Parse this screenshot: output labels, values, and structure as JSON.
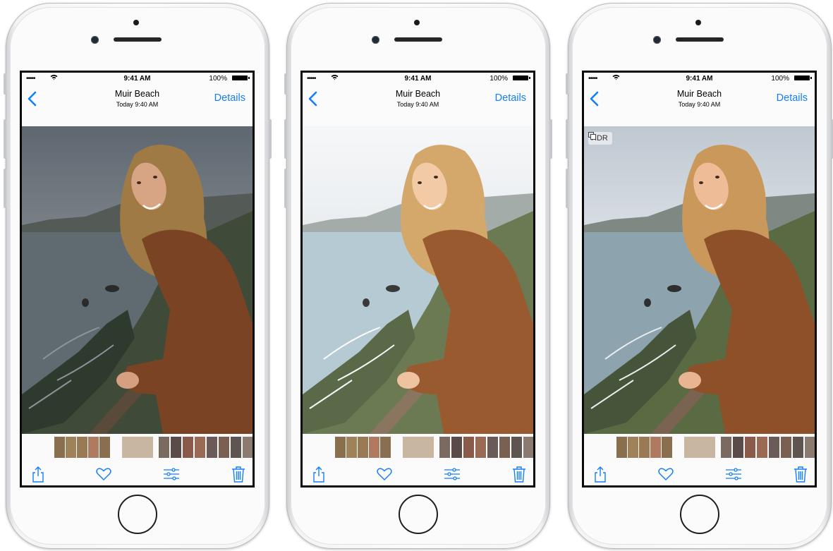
{
  "status": {
    "carrier": "•••••",
    "time": "9:41 AM",
    "battery": "100%"
  },
  "nav": {
    "title": "Muir Beach",
    "subtitle": "Today  9:40 AM",
    "details_label": "Details",
    "back_icon": "chevron-left-icon"
  },
  "hdr_label": "HDR",
  "toolbar": {
    "icons": [
      "share-icon",
      "heart-icon",
      "adjust-icon",
      "trash-icon"
    ]
  },
  "accent_color": "#147efb",
  "phones": [
    {
      "variant": "dark",
      "hdr": false
    },
    {
      "variant": "overexposed",
      "hdr": false
    },
    {
      "variant": "hdr",
      "hdr": true
    }
  ]
}
